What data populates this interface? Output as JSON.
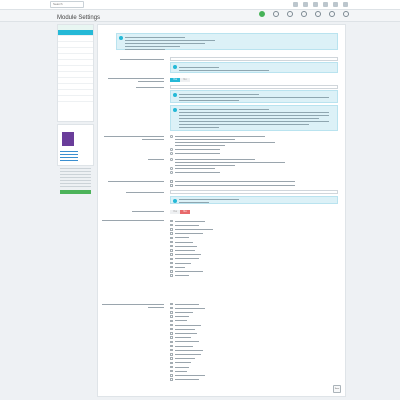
{
  "topbar": {
    "search_placeholder": "Search",
    "icon_count": 6
  },
  "header": {
    "breadcrumb": "",
    "title": "Module Settings",
    "toolbar": [
      {
        "label": "",
        "icon": "check-icon"
      },
      {
        "label": "",
        "icon": "gear-icon"
      },
      {
        "label": "",
        "icon": "book-icon"
      },
      {
        "label": "",
        "icon": "question-icon"
      },
      {
        "label": "",
        "icon": "refresh-icon"
      },
      {
        "label": "",
        "icon": "list-icon"
      },
      {
        "label": "",
        "icon": "help-icon"
      }
    ]
  },
  "sidebar": {
    "title": "",
    "items": [
      {
        "label": "",
        "active": true
      },
      {
        "label": "",
        "active": false
      },
      {
        "label": "",
        "active": false
      },
      {
        "label": "",
        "active": false
      },
      {
        "label": "",
        "active": false
      },
      {
        "label": "",
        "active": false
      },
      {
        "label": "",
        "active": false
      },
      {
        "label": "",
        "active": false
      },
      {
        "label": "",
        "active": false
      },
      {
        "label": "",
        "active": false
      },
      {
        "label": "",
        "active": false
      },
      {
        "label": "",
        "active": false
      }
    ]
  },
  "promo": {
    "title": "",
    "button": ""
  },
  "main": {
    "panel_title": "",
    "toggle1": {
      "yes": "Yes",
      "no": "No",
      "selected": "yes"
    },
    "toggle2": {
      "yes": "Yes",
      "no": "No",
      "selected": "no"
    },
    "select_value": "",
    "list1": [
      "",
      "",
      "",
      "",
      "",
      "",
      "",
      "",
      "",
      "",
      "",
      "",
      "",
      ""
    ],
    "list2": [
      "",
      "",
      "",
      "",
      "",
      "",
      "",
      "",
      "",
      "",
      "",
      "",
      "",
      "",
      "",
      "",
      "",
      "",
      ""
    ]
  },
  "save_label": "Save",
  "colors": {
    "accent": "#25b9d7",
    "success": "#47b359",
    "danger": "#e8696b",
    "info_bg": "#dcf1f7"
  }
}
